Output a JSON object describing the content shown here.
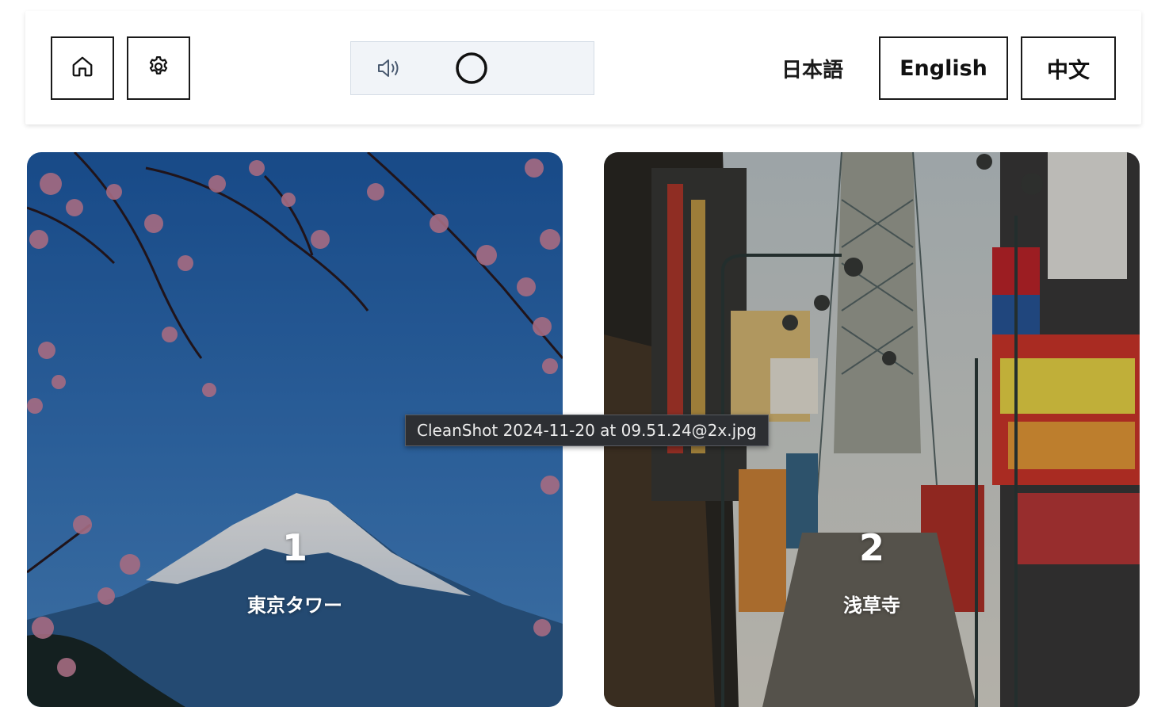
{
  "header": {
    "home_icon": "home-icon",
    "settings_icon": "gear-icon",
    "audio": {
      "speaker_icon": "speaker-icon",
      "indicator_icon": "circle-icon"
    },
    "languages": [
      {
        "label": "日本語",
        "style": "plain"
      },
      {
        "label": "English",
        "style": "outlined"
      },
      {
        "label": "中文",
        "style": "outlined"
      }
    ]
  },
  "cards": [
    {
      "number": "1",
      "title": "東京タワー",
      "image": "mount-fuji-cherry-blossom"
    },
    {
      "number": "2",
      "title": "浅草寺",
      "image": "osaka-shinsekai-street"
    }
  ],
  "tooltip": {
    "text": "CleanShot 2024-11-20 at 09.51.24@2x.jpg"
  },
  "colors": {
    "border": "#1a1a1a",
    "audio_bg": "#f1f4f8",
    "tooltip_bg": "#2d2f33"
  }
}
